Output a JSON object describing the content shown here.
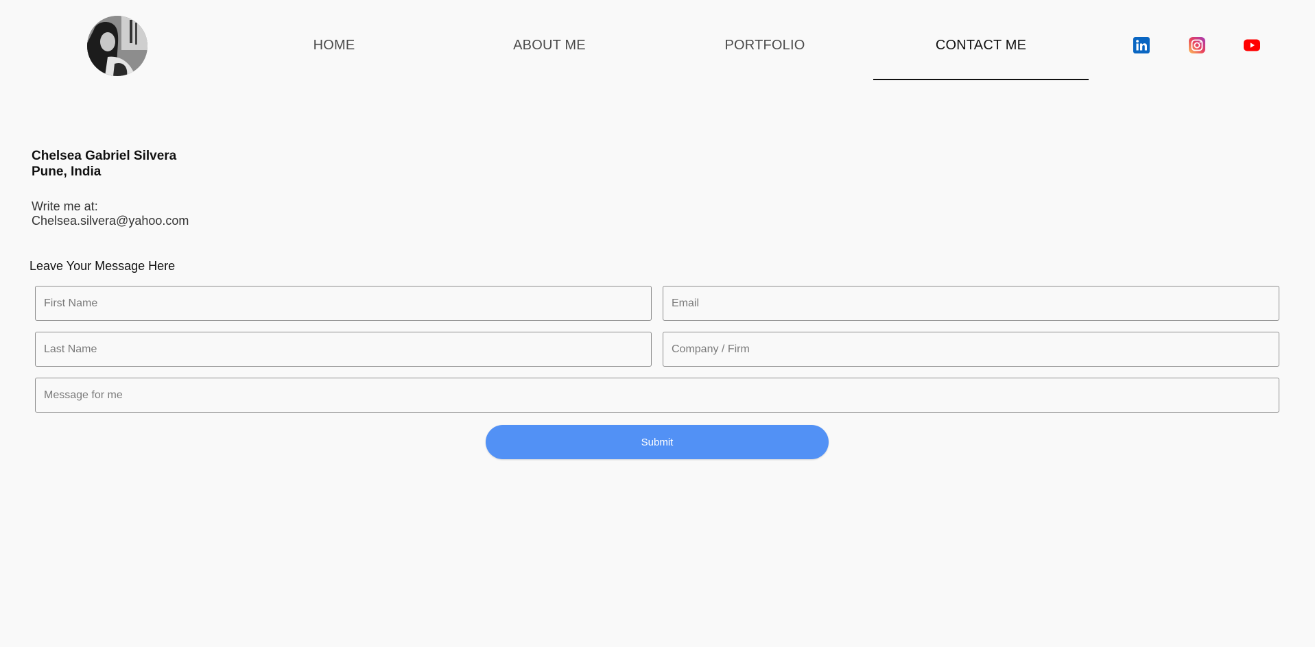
{
  "header": {
    "nav": [
      {
        "label": "HOME",
        "active": false
      },
      {
        "label": "ABOUT ME",
        "active": false
      },
      {
        "label": "PORTFOLIO",
        "active": false
      },
      {
        "label": "CONTACT ME",
        "active": true
      }
    ],
    "social": [
      {
        "icon": "linkedin-icon",
        "color": "#0a66c2"
      },
      {
        "icon": "instagram-icon",
        "color": "#e1306c"
      },
      {
        "icon": "youtube-icon",
        "color": "#ff0000"
      }
    ]
  },
  "contact": {
    "name": "Chelsea Gabriel Silvera",
    "location": "Pune, India",
    "write_label": "Write me at:",
    "email": "Chelsea.silvera@yahoo.com"
  },
  "form": {
    "title": "Leave Your Message Here",
    "first_name_placeholder": "First Name",
    "email_placeholder": "Email",
    "last_name_placeholder": "Last Name",
    "company_placeholder": "Company / Firm",
    "message_placeholder": "Message for me",
    "submit_label": "Submit"
  },
  "colors": {
    "background": "#f9f9f9",
    "accent": "#5291f5",
    "active_underline": "#111111"
  }
}
